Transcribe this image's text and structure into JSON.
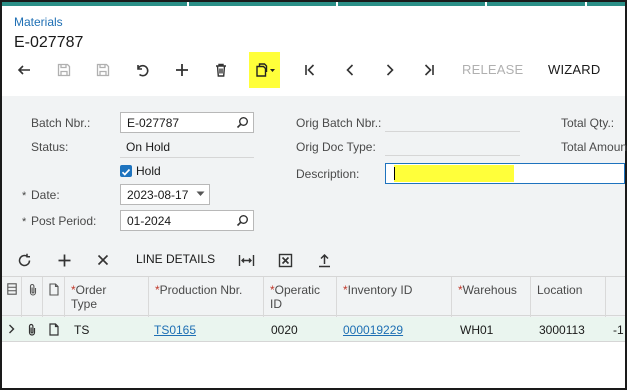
{
  "breadcrumb": "Materials",
  "document_id": "E-027787",
  "toolbar": {
    "release_label": "RELEASE",
    "wizard_label": "WIZARD",
    "highlight_color": "#ffff3a",
    "icons": [
      "back-icon",
      "save-close-icon",
      "save-icon",
      "undo-icon",
      "add-icon",
      "delete-icon",
      "copy-paste-icon",
      "first-icon",
      "previous-icon",
      "next-icon",
      "last-icon"
    ]
  },
  "form": {
    "batch_nbr_label": "Batch Nbr.:",
    "batch_nbr_value": "E-027787",
    "status_label": "Status:",
    "status_value": "On Hold",
    "hold_label": "Hold",
    "hold_checked": true,
    "date_label": "Date:",
    "date_value": "2023-08-17",
    "post_period_label": "Post Period:",
    "post_period_value": "01-2024",
    "orig_batch_nbr_label": "Orig Batch Nbr.:",
    "orig_doc_type_label": "Orig Doc Type:",
    "description_label": "Description:",
    "description_value": "",
    "total_qty_label": "Total Qty.:",
    "total_amount_label": "Total Amount"
  },
  "grid_toolbar": {
    "line_details_label": "LINE DETAILS"
  },
  "grid": {
    "columns": [
      {
        "label_1": "Order",
        "label_2": "Type",
        "required": true
      },
      {
        "label_1": "Production Nbr.",
        "label_2": "",
        "required": true
      },
      {
        "label_1": "Operatic",
        "label_2": "ID",
        "required": true
      },
      {
        "label_1": "Inventory ID",
        "label_2": "",
        "required": true
      },
      {
        "label_1": "Warehous",
        "label_2": "",
        "required": true
      },
      {
        "label_1": "Location",
        "label_2": "",
        "required": false
      }
    ],
    "rows": [
      {
        "order_type": "TS",
        "production_nbr": "TS0165",
        "operation_id": "0020",
        "inventory_id": "000019229",
        "warehouse": "WH01",
        "location": "3000113",
        "qty": "-1"
      }
    ]
  }
}
